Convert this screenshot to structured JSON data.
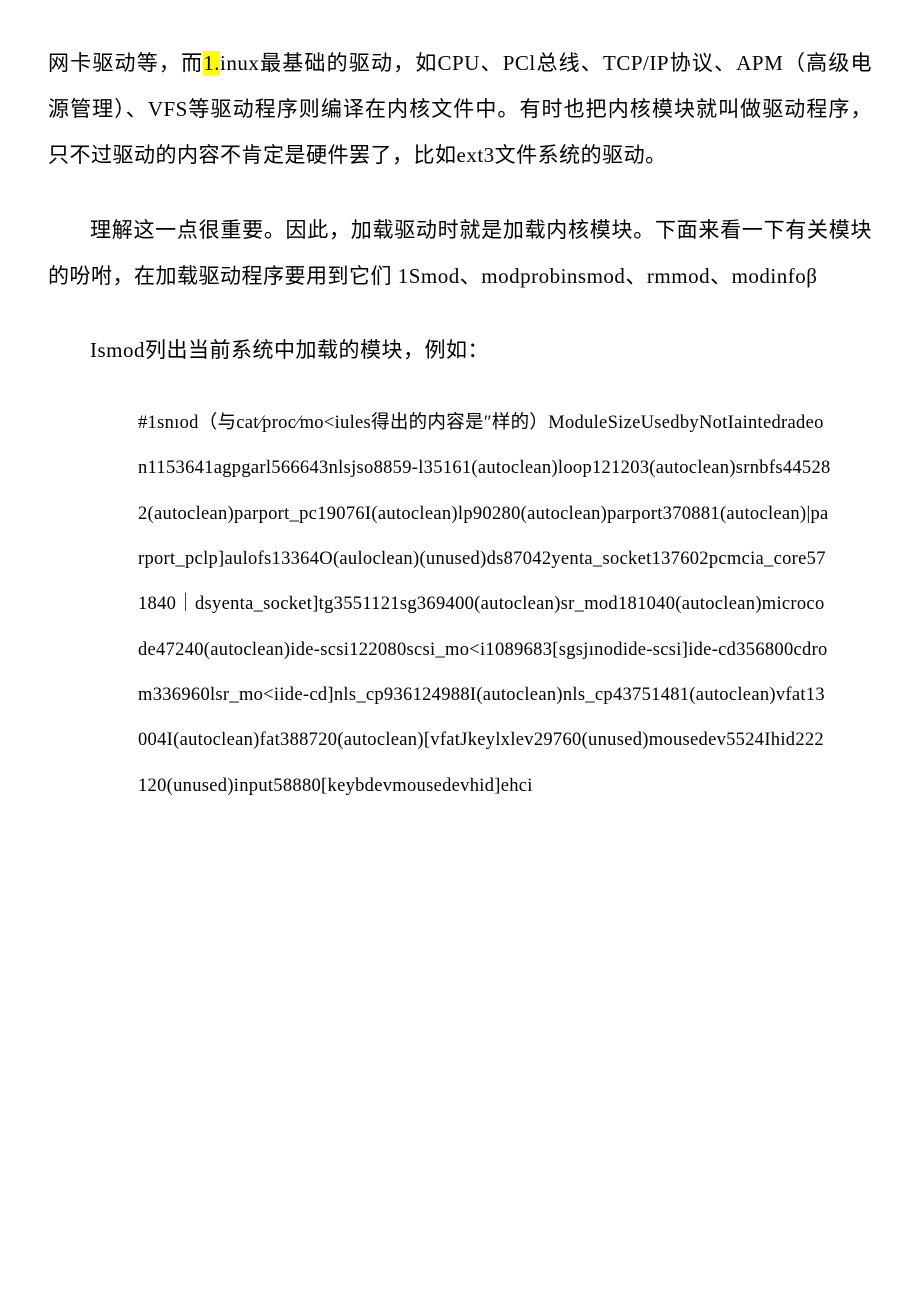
{
  "para1": {
    "pre": "网卡驱动等，而",
    "hl": "1.",
    "post": "inux最基础的驱动，如CPU、PCl总线、TCP/IP协议、APM（高级电源管理）、VFS等驱动程序则编译在内核文件中。有时也把内核模块就叫做驱动程序，只不过驱动的内容不肯定是硬件罢了，比如ext3文件系统的驱动。"
  },
  "para2": "理解这一点很重要。因此，加载驱动时就是加载内核模块。下面来看一下有关模块的吩咐，在加载驱动程序要用到它们  1Smod、modprobinsmod、rmmod、modinfoβ",
  "para3": "Ismod列出当前系统中加载的模块，例如：",
  "code": "#1snıod（与cat⁄proc⁄mo<iules得出的内容是″样的）ModuleSizeUsedbyNotIaintedradeon1153641agpgarl566643nlsjso8859-l35161(autoclean)loop121203(autoclean)srnbfs445282(autoclean)parport_pc19076I(autoclean)lp90280(autoclean)parport370881(autoclean)|parport_pclp]aulofs13364O(auloclean)(unused)ds87042yenta_socket137602pcmcia_core571840｜dsyenta_socket]tg3551121sg369400(autoclean)sr_mod181040(autoclean)microcode47240(autoclean)ide-scsi122080scsi_mo<i1089683[sgsjınodide-scsi]ide-cd356800cdrom336960lsr_mo<iide-cd]nls_cp936124988I(autoclean)nls_cp43751481(autoclean)vfat13004I(autoclean)fat388720(autoclean)[vfatJkeylxlev29760(unused)mousedev5524Ihid222120(unused)input58880[keybdevmousedevhid]ehci"
}
